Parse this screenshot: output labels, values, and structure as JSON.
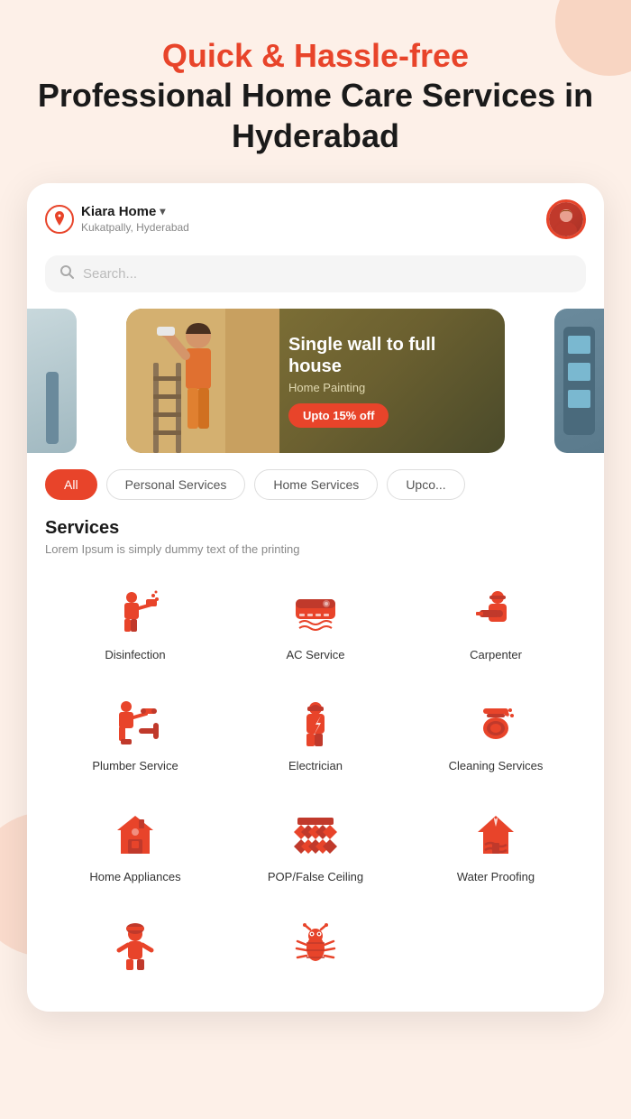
{
  "hero": {
    "accent_line": "Quick & Hassle-free",
    "main_line": "Professional Home Care Services in Hyderabad"
  },
  "header": {
    "location_name": "Kiara Home",
    "location_sub": "Kukatpally, Hyderabad"
  },
  "search": {
    "placeholder": "Search..."
  },
  "banner": {
    "title": "Single wall to full house",
    "subtitle": "Home Painting",
    "cta": "Upto 15% off"
  },
  "filter_tabs": [
    {
      "label": "All",
      "active": true
    },
    {
      "label": "Personal Services",
      "active": false
    },
    {
      "label": "Home Services",
      "active": false
    },
    {
      "label": "Upco...",
      "active": false
    }
  ],
  "services_section": {
    "title": "Services",
    "subtitle": "Lorem Ipsum is simply dummy text of the printing"
  },
  "services": [
    {
      "id": "disinfection",
      "label": "Disinfection",
      "icon": "spray"
    },
    {
      "id": "ac-service",
      "label": "AC Service",
      "icon": "ac"
    },
    {
      "id": "carpenter",
      "label": "Carpenter",
      "icon": "carpenter"
    },
    {
      "id": "plumber",
      "label": "Plumber Service",
      "icon": "plumber"
    },
    {
      "id": "electrician",
      "label": "Electrician",
      "icon": "electrician"
    },
    {
      "id": "cleaning",
      "label": "Cleaning Services",
      "icon": "cleaning"
    },
    {
      "id": "home-appliances",
      "label": "Home Appliances",
      "icon": "appliances"
    },
    {
      "id": "pop-ceiling",
      "label": "POP/False Ceiling",
      "icon": "ceiling"
    },
    {
      "id": "water-proofing",
      "label": "Water Proofing",
      "icon": "waterproof"
    },
    {
      "id": "extra1",
      "label": "",
      "icon": "person"
    },
    {
      "id": "extra2",
      "label": "",
      "icon": "bug"
    }
  ],
  "colors": {
    "accent": "#e8442a",
    "bg": "#fdf0e8"
  }
}
